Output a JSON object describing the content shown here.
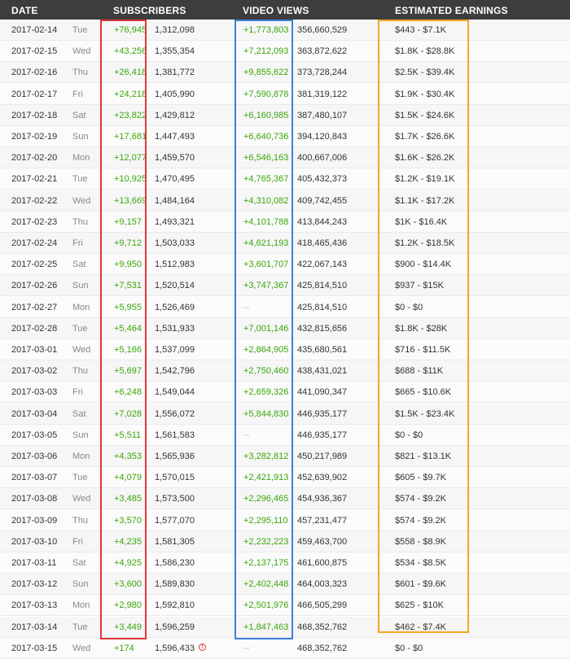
{
  "header": {
    "date": "DATE",
    "subscribers": "SUBSCRIBERS",
    "video_views": "VIDEO VIEWS",
    "earnings": "ESTIMATED EARNINGS"
  },
  "rows": [
    {
      "date": "2017-02-14",
      "day": "Tue",
      "sub_gain": "+76,945",
      "sub_total": "1,312,098",
      "view_gain": "+1,773,803",
      "view_total": "356,660,529",
      "earnings": "$443  -  $7.1K"
    },
    {
      "date": "2017-02-15",
      "day": "Wed",
      "sub_gain": "+43,256",
      "sub_total": "1,355,354",
      "view_gain": "+7,212,093",
      "view_total": "363,872,622",
      "earnings": "$1.8K  -  $28.8K"
    },
    {
      "date": "2017-02-16",
      "day": "Thu",
      "sub_gain": "+26,418",
      "sub_total": "1,381,772",
      "view_gain": "+9,855,622",
      "view_total": "373,728,244",
      "earnings": "$2.5K  -  $39.4K"
    },
    {
      "date": "2017-02-17",
      "day": "Fri",
      "sub_gain": "+24,218",
      "sub_total": "1,405,990",
      "view_gain": "+7,590,878",
      "view_total": "381,319,122",
      "earnings": "$1.9K  -  $30.4K"
    },
    {
      "date": "2017-02-18",
      "day": "Sat",
      "sub_gain": "+23,822",
      "sub_total": "1,429,812",
      "view_gain": "+6,160,985",
      "view_total": "387,480,107",
      "earnings": "$1.5K  -  $24.6K"
    },
    {
      "date": "2017-02-19",
      "day": "Sun",
      "sub_gain": "+17,681",
      "sub_total": "1,447,493",
      "view_gain": "+6,640,736",
      "view_total": "394,120,843",
      "earnings": "$1.7K  -  $26.6K"
    },
    {
      "date": "2017-02-20",
      "day": "Mon",
      "sub_gain": "+12,077",
      "sub_total": "1,459,570",
      "view_gain": "+6,546,163",
      "view_total": "400,667,006",
      "earnings": "$1.6K  -  $26.2K"
    },
    {
      "date": "2017-02-21",
      "day": "Tue",
      "sub_gain": "+10,925",
      "sub_total": "1,470,495",
      "view_gain": "+4,765,367",
      "view_total": "405,432,373",
      "earnings": "$1.2K  -  $19.1K"
    },
    {
      "date": "2017-02-22",
      "day": "Wed",
      "sub_gain": "+13,669",
      "sub_total": "1,484,164",
      "view_gain": "+4,310,082",
      "view_total": "409,742,455",
      "earnings": "$1.1K  -  $17.2K"
    },
    {
      "date": "2017-02-23",
      "day": "Thu",
      "sub_gain": "+9,157",
      "sub_total": "1,493,321",
      "view_gain": "+4,101,788",
      "view_total": "413,844,243",
      "earnings": "$1K  -  $16.4K"
    },
    {
      "date": "2017-02-24",
      "day": "Fri",
      "sub_gain": "+9,712",
      "sub_total": "1,503,033",
      "view_gain": "+4,621,193",
      "view_total": "418,465,436",
      "earnings": "$1.2K  -  $18.5K"
    },
    {
      "date": "2017-02-25",
      "day": "Sat",
      "sub_gain": "+9,950",
      "sub_total": "1,512,983",
      "view_gain": "+3,601,707",
      "view_total": "422,067,143",
      "earnings": "$900  -  $14.4K"
    },
    {
      "date": "2017-02-26",
      "day": "Sun",
      "sub_gain": "+7,531",
      "sub_total": "1,520,514",
      "view_gain": "+3,747,367",
      "view_total": "425,814,510",
      "earnings": "$937  -  $15K"
    },
    {
      "date": "2017-02-27",
      "day": "Mon",
      "sub_gain": "+5,955",
      "sub_total": "1,526,469",
      "view_gain": "--",
      "view_total": "425,814,510",
      "earnings": "$0  -  $0"
    },
    {
      "date": "2017-02-28",
      "day": "Tue",
      "sub_gain": "+5,464",
      "sub_total": "1,531,933",
      "view_gain": "+7,001,146",
      "view_total": "432,815,656",
      "earnings": "$1.8K  -  $28K"
    },
    {
      "date": "2017-03-01",
      "day": "Wed",
      "sub_gain": "+5,166",
      "sub_total": "1,537,099",
      "view_gain": "+2,864,905",
      "view_total": "435,680,561",
      "earnings": "$716  -  $11.5K"
    },
    {
      "date": "2017-03-02",
      "day": "Thu",
      "sub_gain": "+5,697",
      "sub_total": "1,542,796",
      "view_gain": "+2,750,460",
      "view_total": "438,431,021",
      "earnings": "$688  -  $11K"
    },
    {
      "date": "2017-03-03",
      "day": "Fri",
      "sub_gain": "+6,248",
      "sub_total": "1,549,044",
      "view_gain": "+2,659,326",
      "view_total": "441,090,347",
      "earnings": "$665  -  $10.6K"
    },
    {
      "date": "2017-03-04",
      "day": "Sat",
      "sub_gain": "+7,028",
      "sub_total": "1,556,072",
      "view_gain": "+5,844,830",
      "view_total": "446,935,177",
      "earnings": "$1.5K  -  $23.4K"
    },
    {
      "date": "2017-03-05",
      "day": "Sun",
      "sub_gain": "+5,511",
      "sub_total": "1,561,583",
      "view_gain": "--",
      "view_total": "446,935,177",
      "earnings": "$0  -  $0"
    },
    {
      "date": "2017-03-06",
      "day": "Mon",
      "sub_gain": "+4,353",
      "sub_total": "1,565,936",
      "view_gain": "+3,282,812",
      "view_total": "450,217,989",
      "earnings": "$821  -  $13.1K"
    },
    {
      "date": "2017-03-07",
      "day": "Tue",
      "sub_gain": "+4,079",
      "sub_total": "1,570,015",
      "view_gain": "+2,421,913",
      "view_total": "452,639,902",
      "earnings": "$605  -  $9.7K"
    },
    {
      "date": "2017-03-08",
      "day": "Wed",
      "sub_gain": "+3,485",
      "sub_total": "1,573,500",
      "view_gain": "+2,296,465",
      "view_total": "454,936,367",
      "earnings": "$574  -  $9.2K"
    },
    {
      "date": "2017-03-09",
      "day": "Thu",
      "sub_gain": "+3,570",
      "sub_total": "1,577,070",
      "view_gain": "+2,295,110",
      "view_total": "457,231,477",
      "earnings": "$574  -  $9.2K"
    },
    {
      "date": "2017-03-10",
      "day": "Fri",
      "sub_gain": "+4,235",
      "sub_total": "1,581,305",
      "view_gain": "+2,232,223",
      "view_total": "459,463,700",
      "earnings": "$558  -  $8.9K"
    },
    {
      "date": "2017-03-11",
      "day": "Sat",
      "sub_gain": "+4,925",
      "sub_total": "1,586,230",
      "view_gain": "+2,137,175",
      "view_total": "461,600,875",
      "earnings": "$534  -  $8.5K"
    },
    {
      "date": "2017-03-12",
      "day": "Sun",
      "sub_gain": "+3,600",
      "sub_total": "1,589,830",
      "view_gain": "+2,402,448",
      "view_total": "464,003,323",
      "earnings": "$601  -  $9.6K"
    },
    {
      "date": "2017-03-13",
      "day": "Mon",
      "sub_gain": "+2,980",
      "sub_total": "1,592,810",
      "view_gain": "+2,501,976",
      "view_total": "466,505,299",
      "earnings": "$625  -  $10K"
    },
    {
      "date": "2017-03-14",
      "day": "Tue",
      "sub_gain": "+3,449",
      "sub_total": "1,596,259",
      "view_gain": "+1,847,463",
      "view_total": "468,352,762",
      "earnings": "$462  -  $7.4K"
    },
    {
      "date": "2017-03-15",
      "day": "Wed",
      "sub_gain": "+174",
      "sub_total": "1,596,433",
      "view_gain": "--",
      "view_total": "468,352,762",
      "earnings": "$0  -  $0",
      "warning": "!"
    }
  ],
  "colors": {
    "header_bg": "#3d3d3d",
    "gain_green": "#3aa60a",
    "highlight_red": "#e0373a",
    "highlight_blue": "#3f7fdc",
    "highlight_orange": "#f5a623"
  }
}
